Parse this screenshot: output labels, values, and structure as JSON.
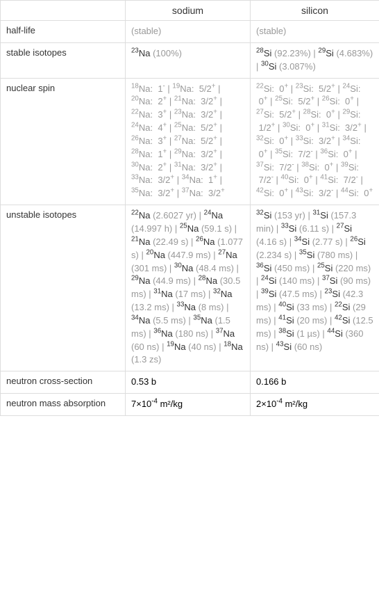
{
  "headers": {
    "col1": "sodium",
    "col2": "silicon"
  },
  "rows": {
    "half_life": {
      "label": "half-life",
      "c1": "(stable)",
      "c2": "(stable)"
    },
    "stable_isotopes": {
      "label": "stable isotopes",
      "c1": [
        {
          "m": "23",
          "el": "Na",
          "note": " (100%)"
        }
      ],
      "c2": [
        {
          "m": "28",
          "el": "Si",
          "note": " (92.23%)",
          "sep": " | "
        },
        {
          "m": "29",
          "el": "Si",
          "note": " (4.683%)",
          "sep": " | "
        },
        {
          "m": "30",
          "el": "Si",
          "note": " (3.087%)"
        }
      ]
    },
    "nuclear_spin": {
      "label": "nuclear spin",
      "c1": [
        {
          "m": "18",
          "el": "Na",
          "spin": "1",
          "sign": "-",
          "sep": " | "
        },
        {
          "m": "19",
          "el": "Na",
          "spin": "5/2",
          "sign": "+",
          "sep": " | "
        },
        {
          "m": "20",
          "el": "Na",
          "spin": "2",
          "sign": "+",
          "sep": " | "
        },
        {
          "m": "21",
          "el": "Na",
          "spin": "3/2",
          "sign": "+",
          "sep": " | "
        },
        {
          "m": "22",
          "el": "Na",
          "spin": "3",
          "sign": "+",
          "sep": " | "
        },
        {
          "m": "23",
          "el": "Na",
          "spin": "3/2",
          "sign": "+",
          "sep": " | "
        },
        {
          "m": "24",
          "el": "Na",
          "spin": "4",
          "sign": "+",
          "sep": " | "
        },
        {
          "m": "25",
          "el": "Na",
          "spin": "5/2",
          "sign": "+",
          "sep": " | "
        },
        {
          "m": "26",
          "el": "Na",
          "spin": "3",
          "sign": "+",
          "sep": " | "
        },
        {
          "m": "27",
          "el": "Na",
          "spin": "5/2",
          "sign": "+",
          "sep": " | "
        },
        {
          "m": "28",
          "el": "Na",
          "spin": "1",
          "sign": "+",
          "sep": " | "
        },
        {
          "m": "29",
          "el": "Na",
          "spin": "3/2",
          "sign": "+",
          "sep": " | "
        },
        {
          "m": "30",
          "el": "Na",
          "spin": "2",
          "sign": "+",
          "sep": " | "
        },
        {
          "m": "31",
          "el": "Na",
          "spin": "3/2",
          "sign": "+",
          "sep": " | "
        },
        {
          "m": "33",
          "el": "Na",
          "spin": "3/2",
          "sign": "+",
          "sep": " | "
        },
        {
          "m": "34",
          "el": "Na",
          "spin": "1",
          "sign": "+",
          "sep": " | "
        },
        {
          "m": "35",
          "el": "Na",
          "spin": "3/2",
          "sign": "+",
          "sep": " | "
        },
        {
          "m": "37",
          "el": "Na",
          "spin": "3/2",
          "sign": "+"
        }
      ],
      "c2": [
        {
          "m": "22",
          "el": "Si",
          "spin": "0",
          "sign": "+",
          "sep": " | "
        },
        {
          "m": "23",
          "el": "Si",
          "spin": "5/2",
          "sign": "+",
          "sep": " | "
        },
        {
          "m": "24",
          "el": "Si",
          "spin": "0",
          "sign": "+",
          "sep": " | "
        },
        {
          "m": "25",
          "el": "Si",
          "spin": "5/2",
          "sign": "+",
          "sep": " | "
        },
        {
          "m": "26",
          "el": "Si",
          "spin": "0",
          "sign": "+",
          "sep": " | "
        },
        {
          "m": "27",
          "el": "Si",
          "spin": "5/2",
          "sign": "+",
          "sep": " | "
        },
        {
          "m": "28",
          "el": "Si",
          "spin": "0",
          "sign": "+",
          "sep": " | "
        },
        {
          "m": "29",
          "el": "Si",
          "spin": "1/2",
          "sign": "+",
          "sep": " | "
        },
        {
          "m": "30",
          "el": "Si",
          "spin": "0",
          "sign": "+",
          "sep": " | "
        },
        {
          "m": "31",
          "el": "Si",
          "spin": "3/2",
          "sign": "+",
          "sep": " | "
        },
        {
          "m": "32",
          "el": "Si",
          "spin": "0",
          "sign": "+",
          "sep": " | "
        },
        {
          "m": "33",
          "el": "Si",
          "spin": "3/2",
          "sign": "+",
          "sep": " | "
        },
        {
          "m": "34",
          "el": "Si",
          "spin": "0",
          "sign": "+",
          "sep": " | "
        },
        {
          "m": "35",
          "el": "Si",
          "spin": "7/2",
          "sign": "-",
          "sep": " | "
        },
        {
          "m": "36",
          "el": "Si",
          "spin": "0",
          "sign": "+",
          "sep": " | "
        },
        {
          "m": "37",
          "el": "Si",
          "spin": "7/2",
          "sign": "-",
          "sep": " | "
        },
        {
          "m": "38",
          "el": "Si",
          "spin": "0",
          "sign": "+",
          "sep": " | "
        },
        {
          "m": "39",
          "el": "Si",
          "spin": "7/2",
          "sign": "-",
          "sep": " | "
        },
        {
          "m": "40",
          "el": "Si",
          "spin": "0",
          "sign": "+",
          "sep": " | "
        },
        {
          "m": "41",
          "el": "Si",
          "spin": "7/2",
          "sign": "-",
          "sep": " | "
        },
        {
          "m": "42",
          "el": "Si",
          "spin": "0",
          "sign": "+",
          "sep": " | "
        },
        {
          "m": "43",
          "el": "Si",
          "spin": "3/2",
          "sign": "-",
          "sep": " | "
        },
        {
          "m": "44",
          "el": "Si",
          "spin": "0",
          "sign": "+"
        }
      ]
    },
    "unstable_isotopes": {
      "label": "unstable isotopes",
      "c1": [
        {
          "m": "22",
          "el": "Na",
          "note": " (2.6027 yr)",
          "sep": " | "
        },
        {
          "m": "24",
          "el": "Na",
          "note": " (14.997 h)",
          "sep": " | "
        },
        {
          "m": "25",
          "el": "Na",
          "note": " (59.1 s)",
          "sep": " | "
        },
        {
          "m": "21",
          "el": "Na",
          "note": " (22.49 s)",
          "sep": " | "
        },
        {
          "m": "26",
          "el": "Na",
          "note": " (1.077 s)",
          "sep": " | "
        },
        {
          "m": "20",
          "el": "Na",
          "note": " (447.9 ms)",
          "sep": " | "
        },
        {
          "m": "27",
          "el": "Na",
          "note": " (301 ms)",
          "sep": " | "
        },
        {
          "m": "30",
          "el": "Na",
          "note": " (48.4 ms)",
          "sep": " | "
        },
        {
          "m": "29",
          "el": "Na",
          "note": " (44.9 ms)",
          "sep": " | "
        },
        {
          "m": "28",
          "el": "Na",
          "note": " (30.5 ms)",
          "sep": " | "
        },
        {
          "m": "31",
          "el": "Na",
          "note": " (17 ms)",
          "sep": " | "
        },
        {
          "m": "32",
          "el": "Na",
          "note": " (13.2 ms)",
          "sep": " | "
        },
        {
          "m": "33",
          "el": "Na",
          "note": " (8 ms)",
          "sep": " | "
        },
        {
          "m": "34",
          "el": "Na",
          "note": " (5.5 ms)",
          "sep": " | "
        },
        {
          "m": "35",
          "el": "Na",
          "note": " (1.5 ms)",
          "sep": " | "
        },
        {
          "m": "36",
          "el": "Na",
          "note": " (180 ns)",
          "sep": " | "
        },
        {
          "m": "37",
          "el": "Na",
          "note": " (60 ns)",
          "sep": " | "
        },
        {
          "m": "19",
          "el": "Na",
          "note": " (40 ns)",
          "sep": " | "
        },
        {
          "m": "18",
          "el": "Na",
          "note": " (1.3 zs)"
        }
      ],
      "c2": [
        {
          "m": "32",
          "el": "Si",
          "note": " (153 yr)",
          "sep": " | "
        },
        {
          "m": "31",
          "el": "Si",
          "note": " (157.3 min)",
          "sep": " | "
        },
        {
          "m": "33",
          "el": "Si",
          "note": " (6.11 s)",
          "sep": " | "
        },
        {
          "m": "27",
          "el": "Si",
          "note": " (4.16 s)",
          "sep": " | "
        },
        {
          "m": "34",
          "el": "Si",
          "note": " (2.77 s)",
          "sep": " | "
        },
        {
          "m": "26",
          "el": "Si",
          "note": " (2.234 s)",
          "sep": " | "
        },
        {
          "m": "35",
          "el": "Si",
          "note": " (780 ms)",
          "sep": " | "
        },
        {
          "m": "36",
          "el": "Si",
          "note": " (450 ms)",
          "sep": " | "
        },
        {
          "m": "25",
          "el": "Si",
          "note": " (220 ms)",
          "sep": " | "
        },
        {
          "m": "24",
          "el": "Si",
          "note": " (140 ms)",
          "sep": " | "
        },
        {
          "m": "37",
          "el": "Si",
          "note": " (90 ms)",
          "sep": " | "
        },
        {
          "m": "39",
          "el": "Si",
          "note": " (47.5 ms)",
          "sep": " | "
        },
        {
          "m": "23",
          "el": "Si",
          "note": " (42.3 ms)",
          "sep": " | "
        },
        {
          "m": "40",
          "el": "Si",
          "note": " (33 ms)",
          "sep": " | "
        },
        {
          "m": "22",
          "el": "Si",
          "note": " (29 ms)",
          "sep": " | "
        },
        {
          "m": "41",
          "el": "Si",
          "note": " (20 ms)",
          "sep": " | "
        },
        {
          "m": "42",
          "el": "Si",
          "note": " (12.5 ms)",
          "sep": " | "
        },
        {
          "m": "38",
          "el": "Si",
          "note": " (1 µs)",
          "sep": " | "
        },
        {
          "m": "44",
          "el": "Si",
          "note": " (360 ns)",
          "sep": " | "
        },
        {
          "m": "43",
          "el": "Si",
          "note": " (60 ns)"
        }
      ]
    },
    "neutron_cross_section": {
      "label": "neutron cross-section",
      "c1": "0.53 b",
      "c2": "0.166 b"
    },
    "neutron_mass_absorption": {
      "label": "neutron mass absorption",
      "c1": {
        "coef": "7",
        "exp": "-4",
        "unit": " m²/kg"
      },
      "c2": {
        "coef": "2",
        "exp": "-4",
        "unit": " m²/kg"
      }
    }
  }
}
